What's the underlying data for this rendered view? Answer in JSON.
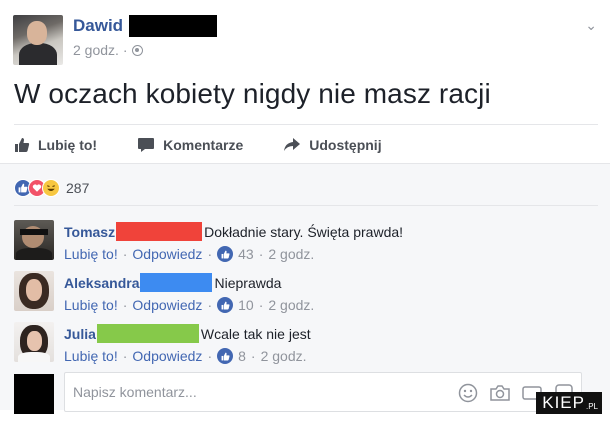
{
  "post": {
    "author_name": "Dawid",
    "time": "2 godz. ·",
    "text": "W oczach kobiety nigdy nie masz racji",
    "menu_icon": "chevron-down-icon",
    "privacy_icon": "globe-icon"
  },
  "actions": [
    {
      "label": "Lubię to!",
      "icon": "thumbs-up-icon"
    },
    {
      "label": "Komentarze",
      "icon": "comment-icon"
    },
    {
      "label": "Udostępnij",
      "icon": "share-icon"
    }
  ],
  "reactions": {
    "icons": [
      "like-reaction-icon",
      "love-reaction-icon",
      "haha-reaction-icon"
    ],
    "count": "287"
  },
  "comments": [
    {
      "author": "Tomasz",
      "redaction_color": "#f0433a",
      "text": "Dokładnie stary. Święta prawda!",
      "like_label": "Lubię to!",
      "reply_label": "Odpowiedz",
      "likes": "43",
      "time": "2 godz."
    },
    {
      "author": "Aleksandra",
      "redaction_color": "#3d8bf1",
      "text": "Nieprawda",
      "like_label": "Lubię to!",
      "reply_label": "Odpowiedz",
      "likes": "10",
      "time": "2 godz."
    },
    {
      "author": "Julia",
      "redaction_color": "#86c94a",
      "text": "Wcale tak nie jest",
      "like_label": "Lubię to!",
      "reply_label": "Odpowiedz",
      "likes": "8",
      "time": "2 godz."
    }
  ],
  "composer": {
    "placeholder": "Napisz komentarz..."
  },
  "watermark": {
    "text": "KIEP",
    "suffix": ".PL"
  },
  "colors": {
    "link": "#365899",
    "like_blue": "#4267b2",
    "meta_gray": "#90949c",
    "background": "#f6f7f9"
  }
}
